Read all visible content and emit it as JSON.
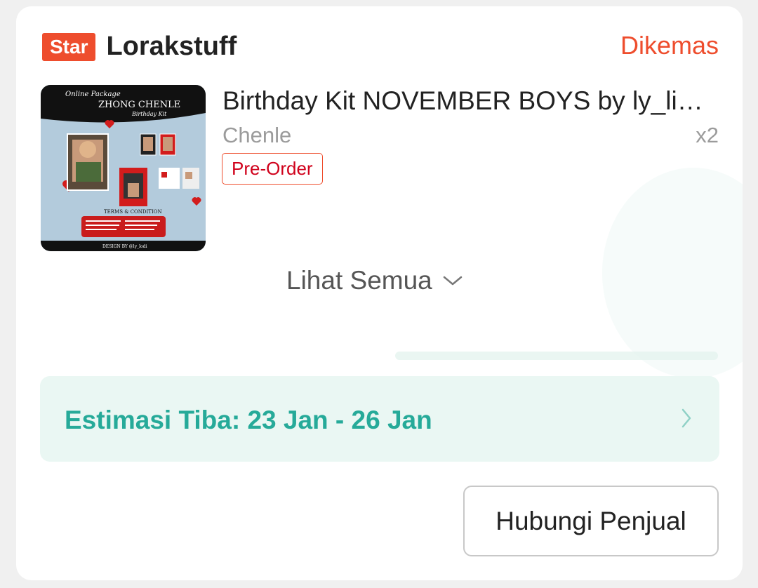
{
  "shop": {
    "badge": "Star",
    "name": "Lorakstuff",
    "status": "Dikemas"
  },
  "item": {
    "title": "Birthday Kit NOVEMBER BOYS by ly_li…",
    "variant": "Chenle",
    "quantity": "x2",
    "tag": "Pre-Order",
    "image": {
      "header_script": "Online Package",
      "header_title": "ZHONG CHENLE",
      "header_sub": "Birthday Kit",
      "terms_title": "TERMS & CONDITION",
      "footer": "DESIGN BY @ly_lodi"
    }
  },
  "see_all": {
    "label": "Lihat Semua"
  },
  "delivery": {
    "estimate": "Estimasi Tiba: 23 Jan - 26 Jan"
  },
  "actions": {
    "contact_seller": "Hubungi Penjual"
  },
  "colors": {
    "brand": "#ee4d2d",
    "eta_text": "#26aa99",
    "eta_bg": "#eaf7f3"
  }
}
